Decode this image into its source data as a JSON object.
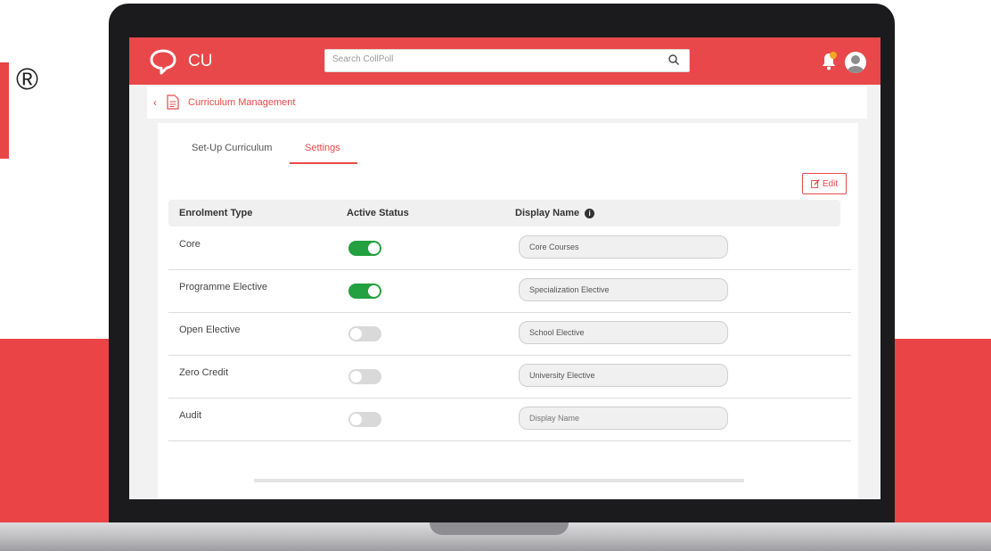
{
  "branding": {
    "registered_mark": "®",
    "app_name": "CU"
  },
  "search": {
    "placeholder": "Search CollPoll"
  },
  "breadcrumb": {
    "title": "Curriculum Management"
  },
  "tabs": [
    {
      "label": "Set-Up Curriculum",
      "active": false
    },
    {
      "label": "Settings",
      "active": true
    }
  ],
  "toolbar": {
    "edit_label": "Edit"
  },
  "table": {
    "headers": {
      "type": "Enrolment Type",
      "status": "Active Status",
      "name": "Display Name"
    },
    "rows": [
      {
        "type": "Core",
        "active": true,
        "display_name": "Core Courses"
      },
      {
        "type": "Programme Elective",
        "active": true,
        "display_name": "Specialization Elective"
      },
      {
        "type": "Open Elective",
        "active": false,
        "display_name": "School Elective"
      },
      {
        "type": "Zero Credit",
        "active": false,
        "display_name": "University Elective"
      },
      {
        "type": "Audit",
        "active": false,
        "display_name": "",
        "placeholder": "Display Name"
      }
    ]
  },
  "colors": {
    "brand": "#e8484a",
    "toggle_on": "#23a03f",
    "toggle_off": "#d9d9d9"
  },
  "icons": [
    "chat-bubble-logo-icon",
    "search-icon",
    "bell-icon",
    "avatar-icon",
    "back-chevron-icon",
    "document-icon",
    "edit-icon",
    "info-icon"
  ]
}
